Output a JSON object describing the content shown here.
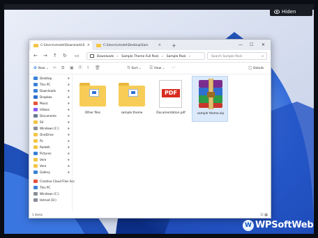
{
  "hide_button": {
    "label": "Hiden"
  },
  "window": {
    "tabs": [
      {
        "label": "C:\\Users\\vmotel\\Downloads\\S",
        "active": true
      },
      {
        "label": "C:\\Users\\vmotel\\Desktop\\Sam",
        "active": false
      }
    ],
    "breadcrumb": [
      "Downloads",
      "Sample Theme Full Pack",
      "Sample Pack"
    ],
    "search_placeholder": "Search Sample Pack",
    "toolbar": {
      "new": "New",
      "sort": "Sort",
      "view": "View",
      "details": "Details"
    },
    "sidebar": [
      {
        "label": "Desktop",
        "icon": "desktop-icon",
        "color": "#3b82d6"
      },
      {
        "label": "This PC",
        "icon": "computer-icon",
        "color": "#3b82d6"
      },
      {
        "label": "Downloads",
        "icon": "download-icon",
        "color": "#3b82d6"
      },
      {
        "label": "Dropbox",
        "icon": "dropbox-icon",
        "color": "#2f6fd0"
      },
      {
        "label": "Music",
        "icon": "music-icon",
        "color": "#e5533d"
      },
      {
        "label": "Videos",
        "icon": "video-icon",
        "color": "#8b5cf6"
      },
      {
        "label": "Documents",
        "icon": "document-icon",
        "color": "#6b7a90"
      },
      {
        "label": "SV",
        "icon": "folder-icon",
        "color": "#f2c544"
      },
      {
        "label": "Windows (C:)",
        "icon": "drive-icon",
        "color": "#8a8f99"
      },
      {
        "label": "OneDrive",
        "icon": "folder-icon",
        "color": "#f2c544"
      },
      {
        "label": "PL",
        "icon": "folder-icon",
        "color": "#f2c544"
      },
      {
        "label": "Redeth",
        "icon": "folder-icon",
        "color": "#f2c544"
      },
      {
        "label": "Pictures",
        "icon": "picture-icon",
        "color": "#3b82d6"
      },
      {
        "label": "Vere",
        "icon": "folder-icon",
        "color": "#f2c544"
      },
      {
        "label": "Vere",
        "icon": "folder-icon",
        "color": "#f2c544"
      },
      {
        "label": "Gallery",
        "icon": "gallery-icon",
        "color": "#3b82d6"
      },
      {
        "label": "Creative Cloud Files Acc",
        "icon": "cloud-icon",
        "color": "#e5533d"
      },
      {
        "label": "This PC",
        "icon": "computer-icon",
        "color": "#3b82d6"
      },
      {
        "label": "Windows (C:)",
        "icon": "drive-icon",
        "color": "#8a8f99"
      },
      {
        "label": "Hdrssd (D:)",
        "icon": "drive-icon",
        "color": "#8a8f99"
      }
    ],
    "files": [
      {
        "name": "Other files",
        "type": "folder"
      },
      {
        "name": "sample theme",
        "type": "folder"
      },
      {
        "name": "Documentation.pdf",
        "type": "pdf",
        "badge": "PDF"
      },
      {
        "name": "sample theme.zip",
        "type": "archive",
        "selected": true
      }
    ],
    "status": "1 items"
  },
  "watermark": "WPSoftWeb"
}
